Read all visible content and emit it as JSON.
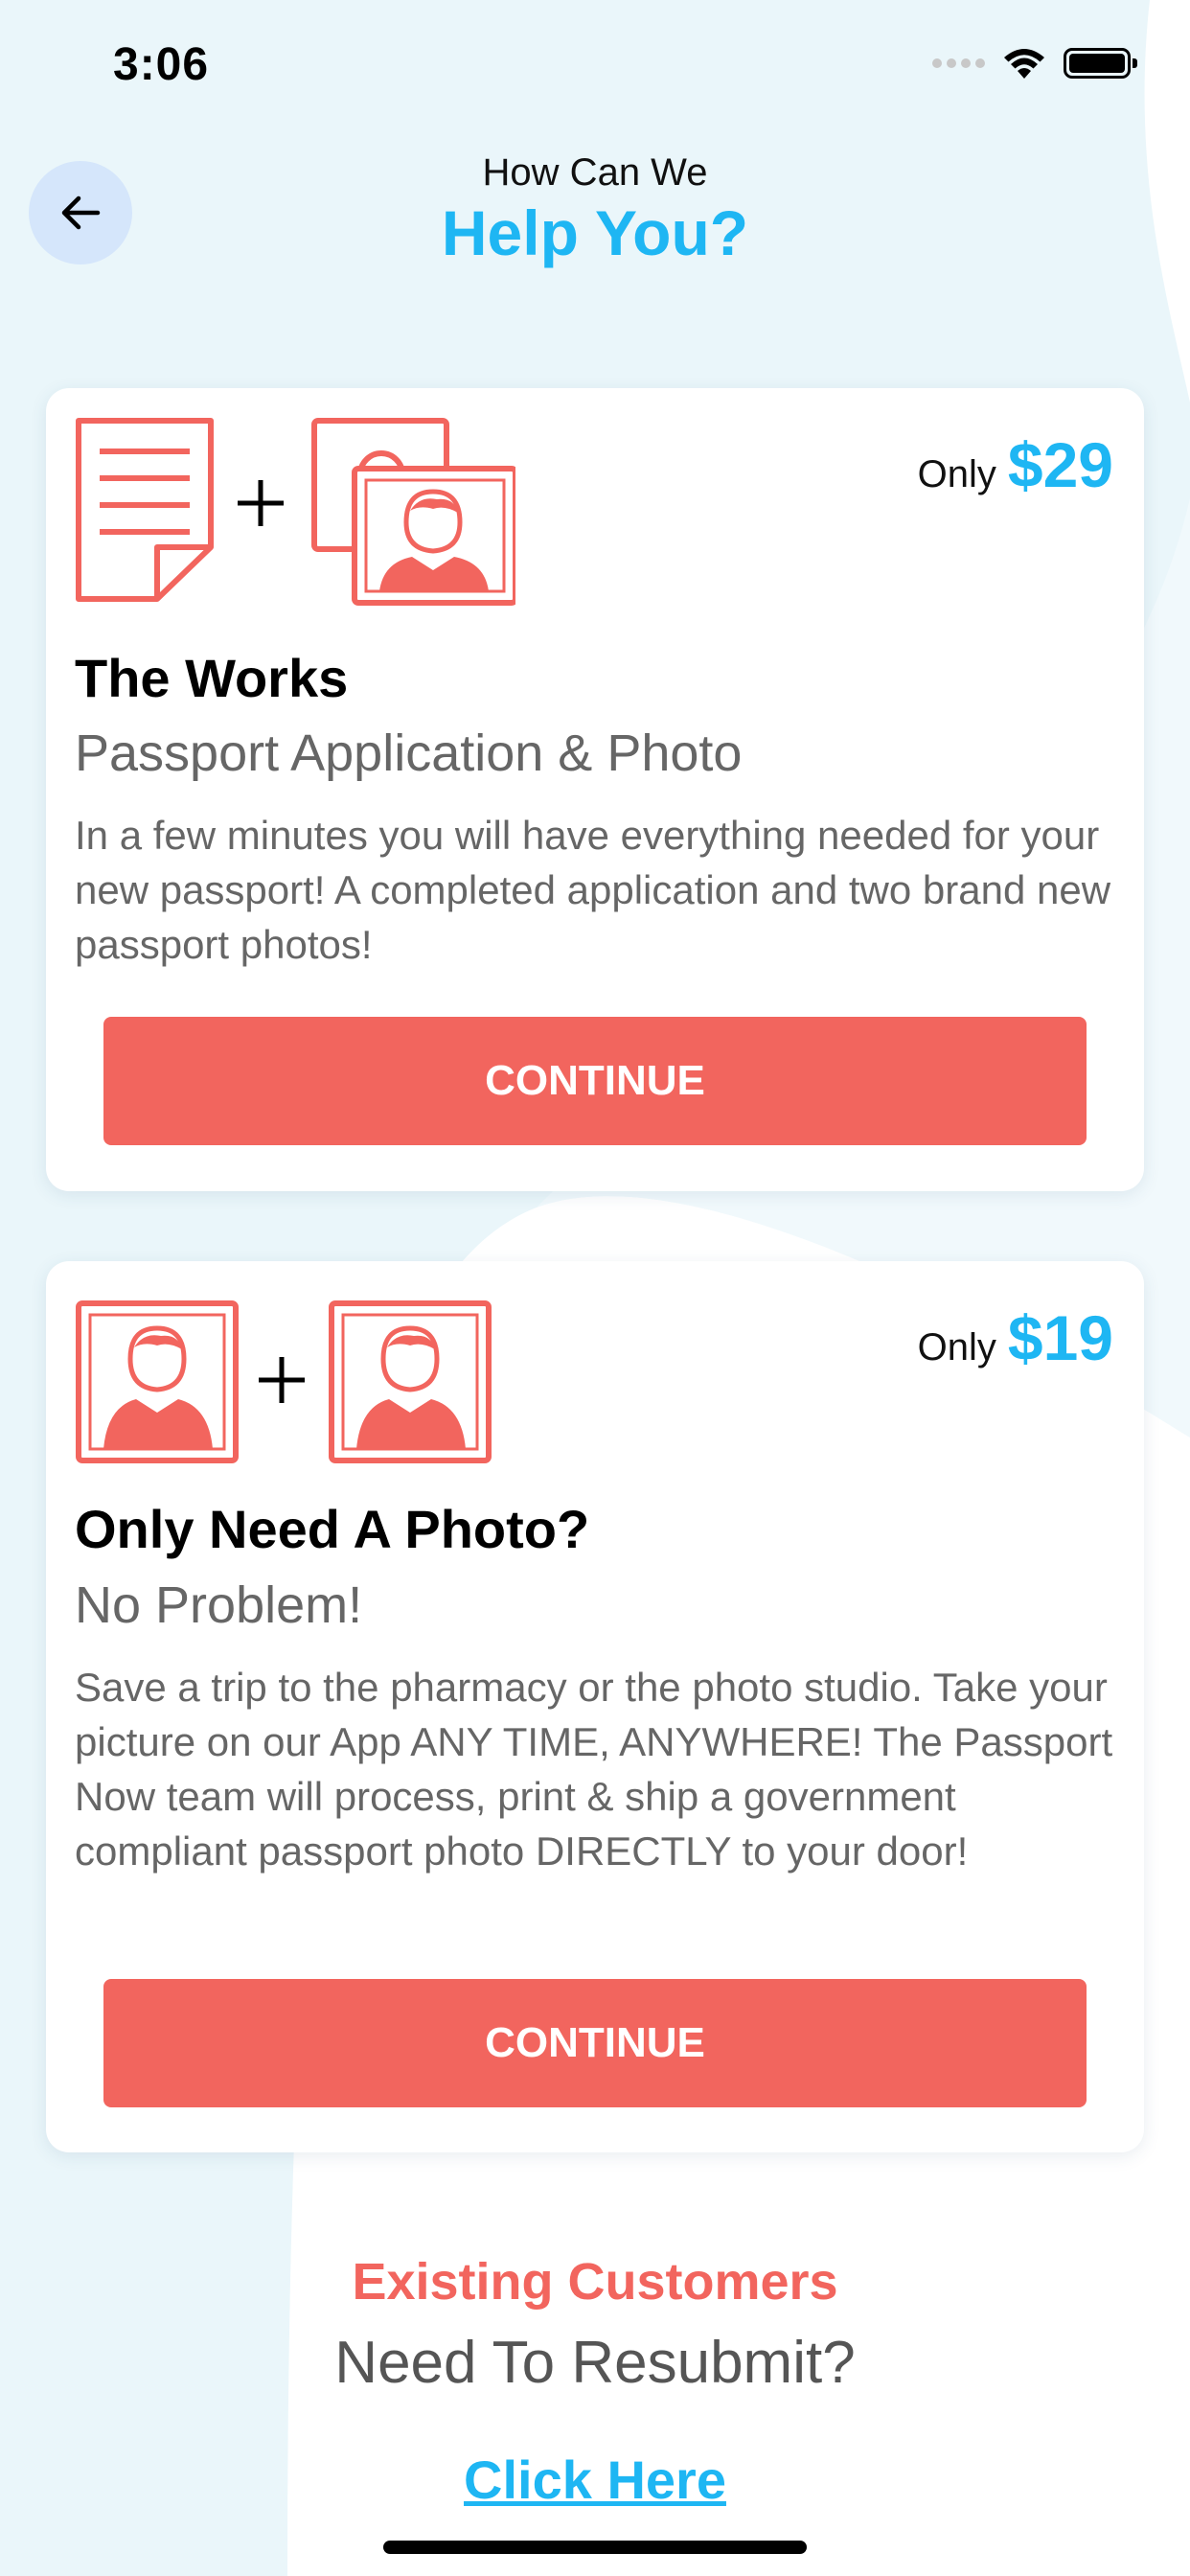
{
  "status_bar": {
    "time": "3:06",
    "icons": [
      "signal-dots-icon",
      "wifi-icon",
      "battery-icon"
    ]
  },
  "header": {
    "subtitle": "How Can We",
    "title": "Help You?",
    "back_icon": "arrow-left-icon"
  },
  "cards": [
    {
      "icons": [
        "document-icon",
        "plus-icon",
        "stacked-photos-icon"
      ],
      "price_prefix": "Only",
      "price": "$29",
      "title": "The Works",
      "subtitle": "Passport Application & Photo",
      "description": "In a few minutes you will have everything needed for your new passport! A completed application and two brand new passport photos!",
      "button_label": "CONTINUE"
    },
    {
      "icons": [
        "photo-icon",
        "plus-icon",
        "photo-icon"
      ],
      "price_prefix": "Only",
      "price": "$19",
      "title": "Only Need A Photo?",
      "subtitle": "No Problem!",
      "description": "Save a trip to the pharmacy or the photo studio. Take your picture on our App ANY TIME, ANYWHERE! The Passport Now team will process, print & ship a government compliant passport photo DIRECTLY to your door!",
      "button_label": "CONTINUE"
    }
  ],
  "footer": {
    "title": "Existing Customers",
    "subtitle": "Need To Resubmit?",
    "link": "Click Here"
  },
  "colors": {
    "accent_blue": "#1eb6f3",
    "accent_coral": "#f2655e",
    "back_button_bg": "#d5e6fb",
    "background_shape": "#eaf6fa"
  }
}
